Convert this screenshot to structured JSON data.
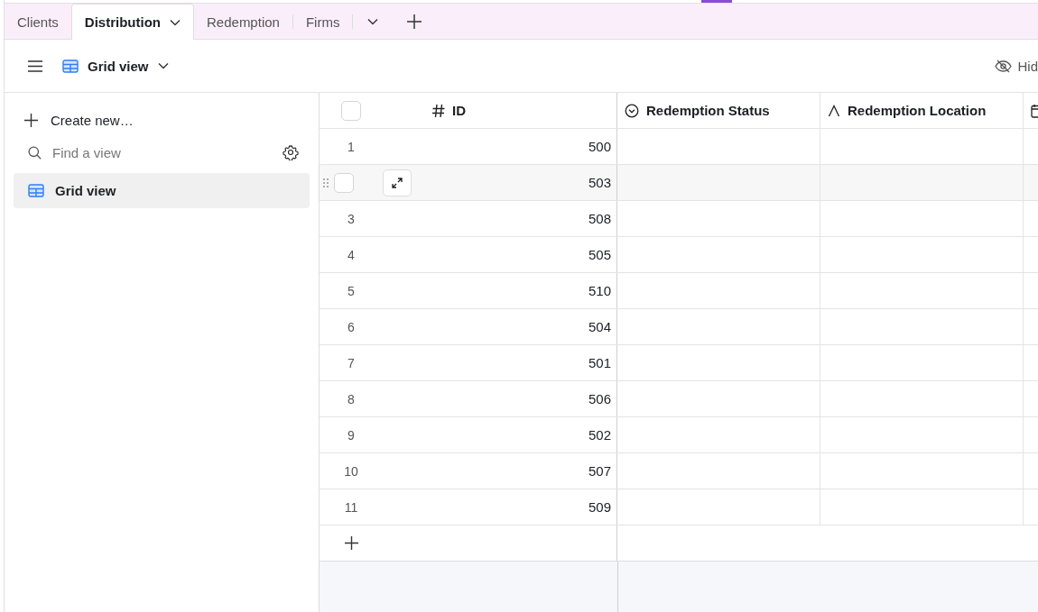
{
  "tabs": [
    {
      "label": "Clients",
      "selected": false,
      "dropdown": false
    },
    {
      "label": "Distribution",
      "selected": true,
      "dropdown": true
    },
    {
      "label": "Redemption",
      "selected": false,
      "dropdown": false
    },
    {
      "label": "Firms",
      "selected": false,
      "dropdown": false
    }
  ],
  "toolbar": {
    "view_name": "Grid view",
    "hide_button": "Hid"
  },
  "sidebar": {
    "create_label": "Create new…",
    "search": {
      "placeholder": "Find a view"
    },
    "items": [
      {
        "label": "Grid view",
        "selected": true
      }
    ]
  },
  "table": {
    "columns": [
      {
        "kind": "number",
        "label": "ID"
      },
      {
        "kind": "status",
        "label": "Redemption Status"
      },
      {
        "kind": "text",
        "label": "Redemption Location"
      },
      {
        "kind": "date"
      }
    ],
    "select_all_checked": false,
    "rows": [
      {
        "number": "1",
        "id": "500",
        "hovered": false
      },
      {
        "id": "503",
        "hovered": true,
        "checked": false
      },
      {
        "number": "3",
        "id": "508",
        "hovered": false
      },
      {
        "number": "4",
        "id": "505",
        "hovered": false
      },
      {
        "number": "5",
        "id": "510",
        "hovered": false
      },
      {
        "number": "6",
        "id": "504",
        "hovered": false
      },
      {
        "number": "7",
        "id": "501",
        "hovered": false
      },
      {
        "number": "8",
        "id": "506",
        "hovered": false
      },
      {
        "number": "9",
        "id": "502",
        "hovered": false
      },
      {
        "number": "10",
        "id": "507",
        "hovered": false
      },
      {
        "number": "11",
        "id": "509",
        "hovered": false
      }
    ]
  }
}
